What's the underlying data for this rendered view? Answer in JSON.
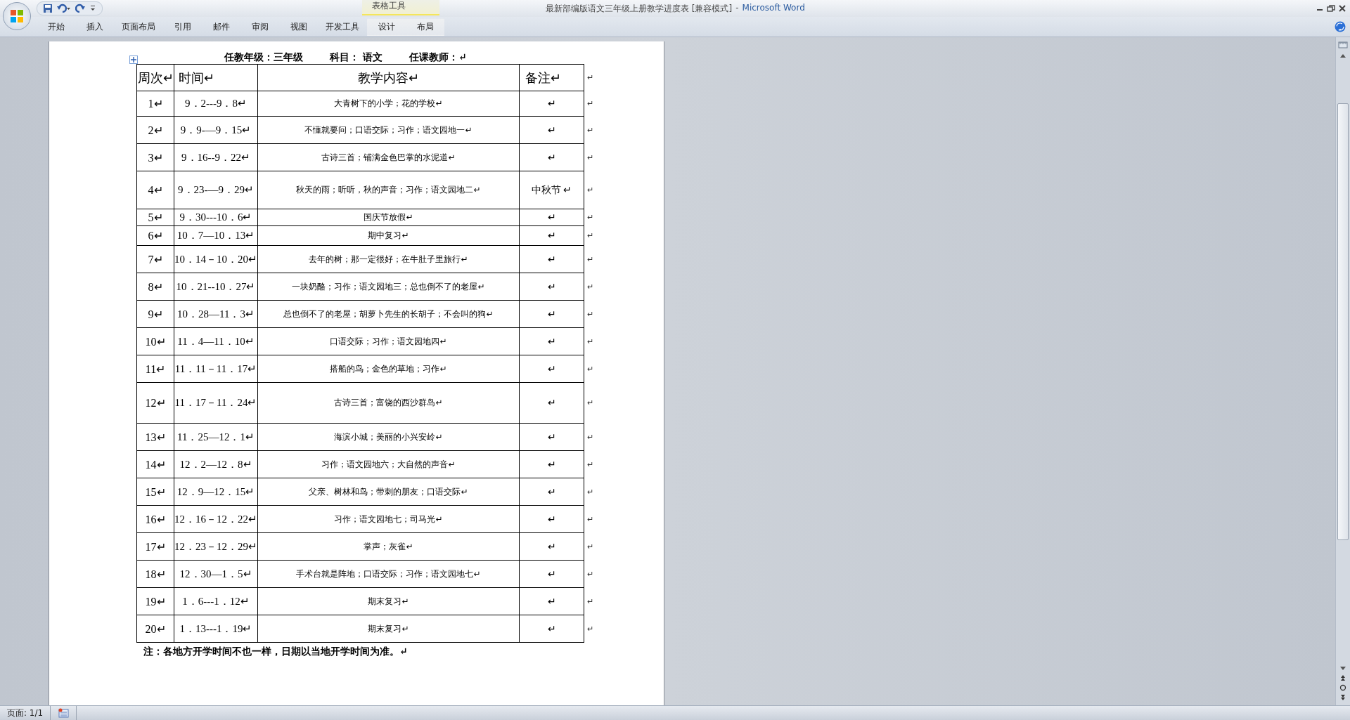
{
  "window": {
    "title": "最新部编版语文三年级上册教学进度表 [兼容模式]",
    "separator": "-",
    "app": "Microsoft Word"
  },
  "ribbon": {
    "contextual_group": "表格工具",
    "tabs": [
      {
        "label": "开始",
        "selected": false,
        "contextual": false
      },
      {
        "label": "插入",
        "selected": false,
        "contextual": false
      },
      {
        "label": "页面布局",
        "selected": false,
        "contextual": false
      },
      {
        "label": "引用",
        "selected": false,
        "contextual": false
      },
      {
        "label": "邮件",
        "selected": false,
        "contextual": false
      },
      {
        "label": "审阅",
        "selected": false,
        "contextual": false
      },
      {
        "label": "视图",
        "selected": false,
        "contextual": false
      },
      {
        "label": "开发工具",
        "selected": false,
        "contextual": false
      },
      {
        "label": "设计",
        "selected": false,
        "contextual": true
      },
      {
        "label": "布局",
        "selected": false,
        "contextual": true
      }
    ]
  },
  "document": {
    "heading": [
      "任教年级：三年级",
      "科目：  语文",
      "任课教师：↵"
    ],
    "table": {
      "columns": [
        "周次↵",
        "时间↵",
        "教学内容↵",
        "备注↵"
      ],
      "header_end_mark": "↵",
      "rows": [
        {
          "week": "1↵",
          "dates": "9．2---9．8↵",
          "content": "大青树下的小学；花的学校↵",
          "remark": "↵",
          "end_mark": "↵"
        },
        {
          "week": "2↵",
          "dates": "9．9-—9．15↵",
          "content": "不懂就要问；口语交际；习作；语文园地一↵",
          "remark": "↵",
          "end_mark": "↵"
        },
        {
          "week": "3↵",
          "dates": "9．16--9．22↵",
          "content": "古诗三首；铺满金色巴掌的水泥道↵",
          "remark": "↵",
          "end_mark": "↵"
        },
        {
          "week": "4↵",
          "dates": "9．23-—9．29↵",
          "content": "秋天的雨；听听，秋的声音；习作；语文园地二↵",
          "remark": "中秋节 ↵",
          "end_mark": "↵"
        },
        {
          "week": "5↵",
          "dates": "9．30---10．6↵",
          "content": "国庆节放假↵",
          "remark": "↵",
          "end_mark": "↵"
        },
        {
          "week": "6↵",
          "dates": "10．7—10．13↵",
          "content": "期中复习↵",
          "remark": "↵",
          "end_mark": "↵"
        },
        {
          "week": "7↵",
          "dates": "10．14－10．20↵",
          "content": "去年的树；那一定很好；在牛肚子里旅行↵",
          "remark": "↵",
          "end_mark": "↵"
        },
        {
          "week": "8↵",
          "dates": "10．21--10．27↵",
          "content": "一块奶酪；习作；语文园地三；总也倒不了的老屋↵",
          "remark": "↵",
          "end_mark": "↵"
        },
        {
          "week": "9↵",
          "dates": "10．28—11．3↵",
          "content": "总也倒不了的老屋；胡萝卜先生的长胡子；不会叫的狗↵",
          "remark": "↵",
          "end_mark": "↵"
        },
        {
          "week": "10↵",
          "dates": "11．4—11．10↵",
          "content": "口语交际；习作；语文园地四↵",
          "remark": "↵",
          "end_mark": "↵"
        },
        {
          "week": "11↵",
          "dates": "11．11－11．17↵",
          "content": "搭船的鸟；金色的草地；习作↵",
          "remark": "↵",
          "end_mark": "↵"
        },
        {
          "week": "12↵",
          "dates": "11．17－11．24↵",
          "content": "古诗三首；富饶的西沙群岛↵",
          "remark": "↵",
          "end_mark": "↵"
        },
        {
          "week": "13↵",
          "dates": "11．25—12．1↵",
          "content": "海滨小城；美丽的小兴安岭↵",
          "remark": "↵",
          "end_mark": "↵"
        },
        {
          "week": "14↵",
          "dates": "12．2—12．8↵",
          "content": "习作；语文园地六；大自然的声音↵",
          "remark": "↵",
          "end_mark": "↵"
        },
        {
          "week": "15↵",
          "dates": "12．9—12．15↵",
          "content": "父亲、树林和鸟；带刺的朋友；口语交际↵",
          "remark": "↵",
          "end_mark": "↵"
        },
        {
          "week": "16↵",
          "dates": "12．16－12．22↵",
          "content": "习作；语文园地七；司马光↵",
          "remark": "↵",
          "end_mark": "↵"
        },
        {
          "week": "17↵",
          "dates": "12．23－12．29↵",
          "content": "掌声；灰雀↵",
          "remark": "↵",
          "end_mark": "↵"
        },
        {
          "week": "18↵",
          "dates": "12．30—1．5↵",
          "content": "手术台就是阵地；口语交际；习作；语文园地七↵",
          "remark": "↵",
          "end_mark": "↵"
        },
        {
          "week": "19↵",
          "dates": "1．6---1．12↵",
          "content": "期末复习↵",
          "remark": "↵",
          "end_mark": "↵"
        },
        {
          "week": "20↵",
          "dates": "1．13---1．19↵",
          "content": "期末复习↵",
          "remark": "↵",
          "end_mark": "↵"
        }
      ]
    },
    "note": "注：各地方开学时间不也一样，日期以当地开学时间为准。↵"
  },
  "status_bar": {
    "page": "页面: 1/1"
  }
}
